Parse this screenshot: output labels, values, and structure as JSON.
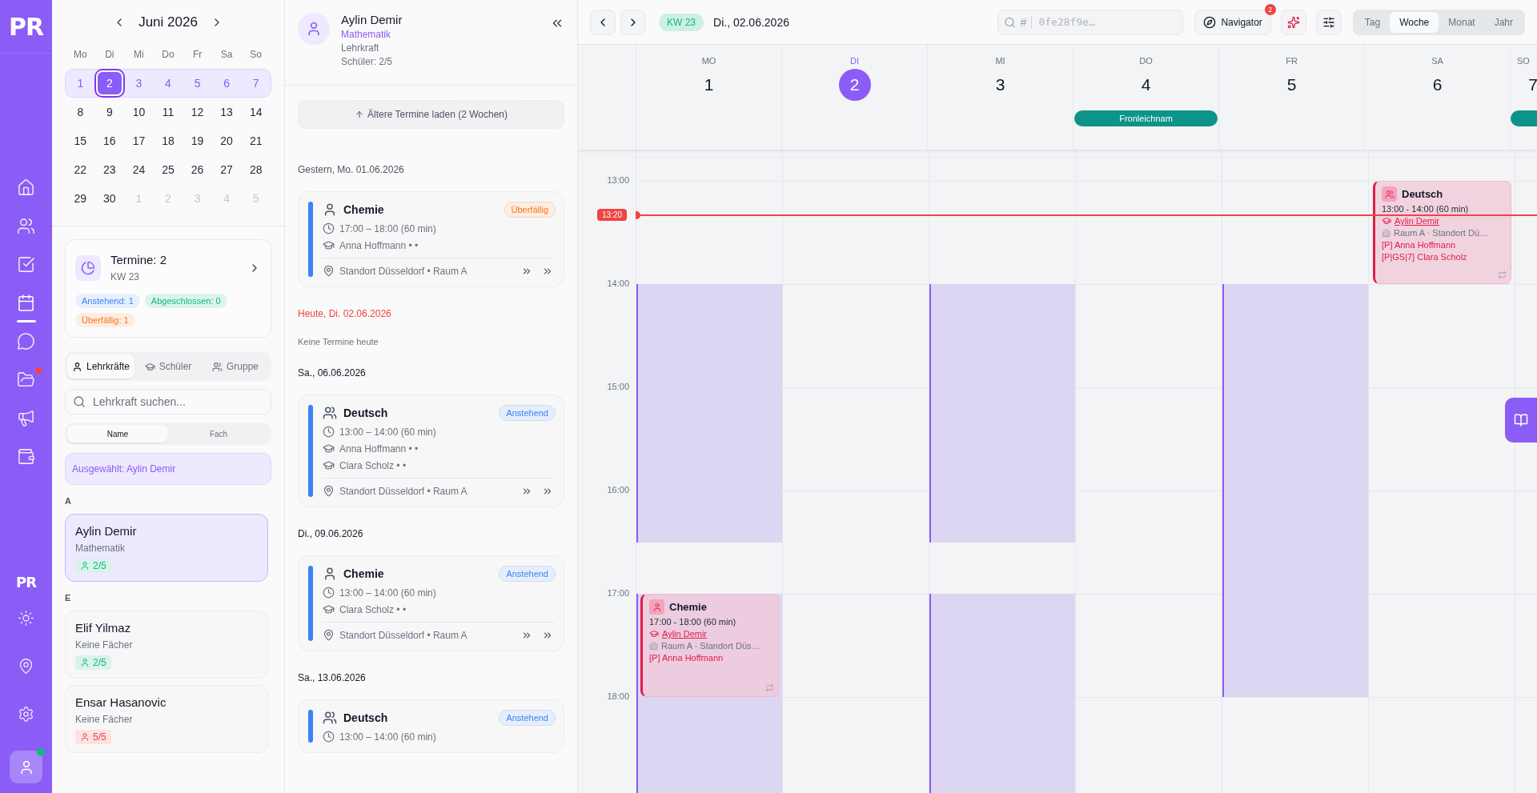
{
  "rail": {
    "logo": "PR",
    "items": [
      {
        "selected": false,
        "notification": false
      },
      {
        "selected": false,
        "notification": false
      },
      {
        "selected": false,
        "notification": false
      },
      {
        "selected": true,
        "notification": false
      },
      {
        "selected": false,
        "notification": false
      },
      {
        "selected": false,
        "notification": true
      },
      {
        "selected": false,
        "notification": false
      },
      {
        "selected": false,
        "notification": false
      }
    ],
    "footer_logo": "PR",
    "avatar": {
      "online": true
    }
  },
  "mini_calendar": {
    "title": "Juni 2026",
    "weekdays": [
      "Mo",
      "Di",
      "Mi",
      "Do",
      "Fr",
      "Sa",
      "So"
    ],
    "weeks": [
      {
        "selected": true,
        "days": [
          {
            "label": "1",
            "selected": false,
            "muted": false
          },
          {
            "label": "2",
            "selected": true,
            "muted": false
          },
          {
            "label": "3",
            "selected": false,
            "muted": false
          },
          {
            "label": "4",
            "selected": false,
            "muted": false
          },
          {
            "label": "5",
            "selected": false,
            "muted": false
          },
          {
            "label": "6",
            "selected": false,
            "muted": false
          },
          {
            "label": "7",
            "selected": false,
            "muted": false
          }
        ]
      },
      {
        "selected": false,
        "days": [
          {
            "label": "8",
            "selected": false,
            "muted": false
          },
          {
            "label": "9",
            "selected": false,
            "muted": false
          },
          {
            "label": "10",
            "selected": false,
            "muted": false
          },
          {
            "label": "11",
            "selected": false,
            "muted": false
          },
          {
            "label": "12",
            "selected": false,
            "muted": false
          },
          {
            "label": "13",
            "selected": false,
            "muted": false
          },
          {
            "label": "14",
            "selected": false,
            "muted": false
          }
        ]
      },
      {
        "selected": false,
        "days": [
          {
            "label": "15",
            "selected": false,
            "muted": false
          },
          {
            "label": "16",
            "selected": false,
            "muted": false
          },
          {
            "label": "17",
            "selected": false,
            "muted": false
          },
          {
            "label": "18",
            "selected": false,
            "muted": false
          },
          {
            "label": "19",
            "selected": false,
            "muted": false
          },
          {
            "label": "20",
            "selected": false,
            "muted": false
          },
          {
            "label": "21",
            "selected": false,
            "muted": false
          }
        ]
      },
      {
        "selected": false,
        "days": [
          {
            "label": "22",
            "selected": false,
            "muted": false
          },
          {
            "label": "23",
            "selected": false,
            "muted": false
          },
          {
            "label": "24",
            "selected": false,
            "muted": false
          },
          {
            "label": "25",
            "selected": false,
            "muted": false
          },
          {
            "label": "26",
            "selected": false,
            "muted": false
          },
          {
            "label": "27",
            "selected": false,
            "muted": false
          },
          {
            "label": "28",
            "selected": false,
            "muted": false
          }
        ]
      },
      {
        "selected": false,
        "days": [
          {
            "label": "29",
            "selected": false,
            "muted": false
          },
          {
            "label": "30",
            "selected": false,
            "muted": false
          },
          {
            "label": "1",
            "selected": false,
            "muted": true
          },
          {
            "label": "2",
            "selected": false,
            "muted": true
          },
          {
            "label": "3",
            "selected": false,
            "muted": true
          },
          {
            "label": "4",
            "selected": false,
            "muted": true
          },
          {
            "label": "5",
            "selected": false,
            "muted": true
          }
        ]
      }
    ]
  },
  "summary": {
    "title": "Termine: 2",
    "subtitle": "KW 23",
    "chips": [
      {
        "kind": "pending",
        "label": "Anstehend: 1"
      },
      {
        "kind": "done",
        "label": "Abgeschlossen: 0"
      },
      {
        "kind": "overdue",
        "label": "Überfällig: 1"
      }
    ]
  },
  "people_tabs": [
    {
      "label": "Lehrkräfte",
      "selected": true
    },
    {
      "label": "Schüler",
      "selected": false
    },
    {
      "label": "Gruppe",
      "selected": false
    }
  ],
  "people_search": {
    "placeholder": "Lehrkraft suchen..."
  },
  "sort": [
    {
      "label": "Name",
      "selected": true
    },
    {
      "label": "Fach",
      "selected": false
    }
  ],
  "selection": "Ausgewählt: Aylin Demir",
  "groups": [
    {
      "letter": "A",
      "items": [
        {
          "name": "Aylin Demir",
          "subject": "Mathematik",
          "count": "2/5",
          "full": false,
          "selected": true
        }
      ]
    },
    {
      "letter": "E",
      "items": [
        {
          "name": "Elif Yilmaz",
          "subject": "Keine Fächer",
          "count": "2/5",
          "full": false,
          "selected": false
        },
        {
          "name": "Ensar Hasanovic",
          "subject": "Keine Fächer",
          "count": "5/5",
          "full": true,
          "selected": false
        }
      ]
    }
  ],
  "detail": {
    "name": "Aylin Demir",
    "subject": "Mathematik",
    "role": "Lehrkraft",
    "students": "Schüler: 2/5",
    "load_older": "Ältere Termine laden (2 Wochen)",
    "sections": [
      {
        "label": "Gestern, Mo. 01.06.2026",
        "kind": "past",
        "appointments": [
          {
            "kind": "single",
            "subject": "Chemie",
            "status": {
              "kind": "overdue",
              "label": "Überfällig"
            },
            "time": "17:00 – 18:00 (60 min)",
            "participants": [
              "Anna Hoffmann • •"
            ],
            "location": "Standort Düsseldorf • Raum A"
          }
        ]
      },
      {
        "label": "Heute, Di. 02.06.2026",
        "kind": "today",
        "empty": "Keine Termine heute"
      },
      {
        "label": "Sa., 06.06.2026",
        "kind": "future",
        "appointments": [
          {
            "kind": "group",
            "subject": "Deutsch",
            "status": {
              "kind": "pending",
              "label": "Anstehend"
            },
            "time": "13:00 – 14:00 (60 min)",
            "participants": [
              "Anna Hoffmann • •",
              "Clara Scholz • •"
            ],
            "location": "Standort Düsseldorf • Raum A"
          }
        ]
      },
      {
        "label": "Di., 09.06.2026",
        "kind": "future",
        "appointments": [
          {
            "kind": "single",
            "subject": "Chemie",
            "status": {
              "kind": "pending",
              "label": "Anstehend"
            },
            "time": "13:00 – 14:00 (60 min)",
            "participants": [
              "Clara Scholz • •"
            ],
            "location": "Standort Düsseldorf • Raum A"
          }
        ]
      },
      {
        "label": "Sa., 13.06.2026",
        "kind": "future",
        "appointments": [
          {
            "kind": "group",
            "subject": "Deutsch",
            "status": {
              "kind": "pending",
              "label": "Anstehend"
            },
            "time": "13:00 – 14:00 (60 min)"
          }
        ]
      }
    ]
  },
  "toolbar": {
    "week": "KW 23",
    "date": "Di., 02.06.2026",
    "search": {
      "prefix": "#",
      "placeholder": "0fe28f9e…"
    },
    "navigator": {
      "label": "Navigator",
      "badge": "2"
    },
    "views": [
      {
        "label": "Tag",
        "selected": false
      },
      {
        "label": "Woche",
        "selected": true
      },
      {
        "label": "Monat",
        "selected": false
      },
      {
        "label": "Jahr",
        "selected": false
      }
    ]
  },
  "week": {
    "hours": [
      "13:00",
      "14:00",
      "15:00",
      "16:00",
      "17:00",
      "18:00"
    ],
    "now": {
      "label": "13:20"
    },
    "days": [
      {
        "weekday": "MO",
        "number": "1",
        "today": false,
        "kind": "split",
        "events": [
          {
            "kind": "single",
            "subject": "Chemie",
            "time": "17:00 - 18:00 (60 min)",
            "student": "Aylin Demir",
            "room": "Raum A · Standort Düs…",
            "participants": [
              "[P] Anna Hoffmann"
            ]
          }
        ]
      },
      {
        "weekday": "DI",
        "number": "2",
        "today": true,
        "kind": "open"
      },
      {
        "weekday": "MI",
        "number": "3",
        "today": false,
        "kind": "split"
      },
      {
        "weekday": "DO",
        "number": "4",
        "today": false,
        "kind": "open",
        "holiday": "Fronleichnam"
      },
      {
        "weekday": "FR",
        "number": "5",
        "today": false,
        "kind": "long"
      },
      {
        "weekday": "SA",
        "number": "6",
        "today": false,
        "kind": "open",
        "events": [
          {
            "kind": "group",
            "subject": "Deutsch",
            "time": "13:00 - 14:00 (60 min)",
            "student": "Aylin Demir",
            "room": "Raum A · Standort Dü…",
            "participants": [
              "[P] Anna Hoffmann",
              "[P|GS|7] Clara Scholz"
            ]
          }
        ]
      },
      {
        "weekday": "SO",
        "number": "7",
        "today": false,
        "kind": "open",
        "has_holiday": true
      }
    ]
  }
}
